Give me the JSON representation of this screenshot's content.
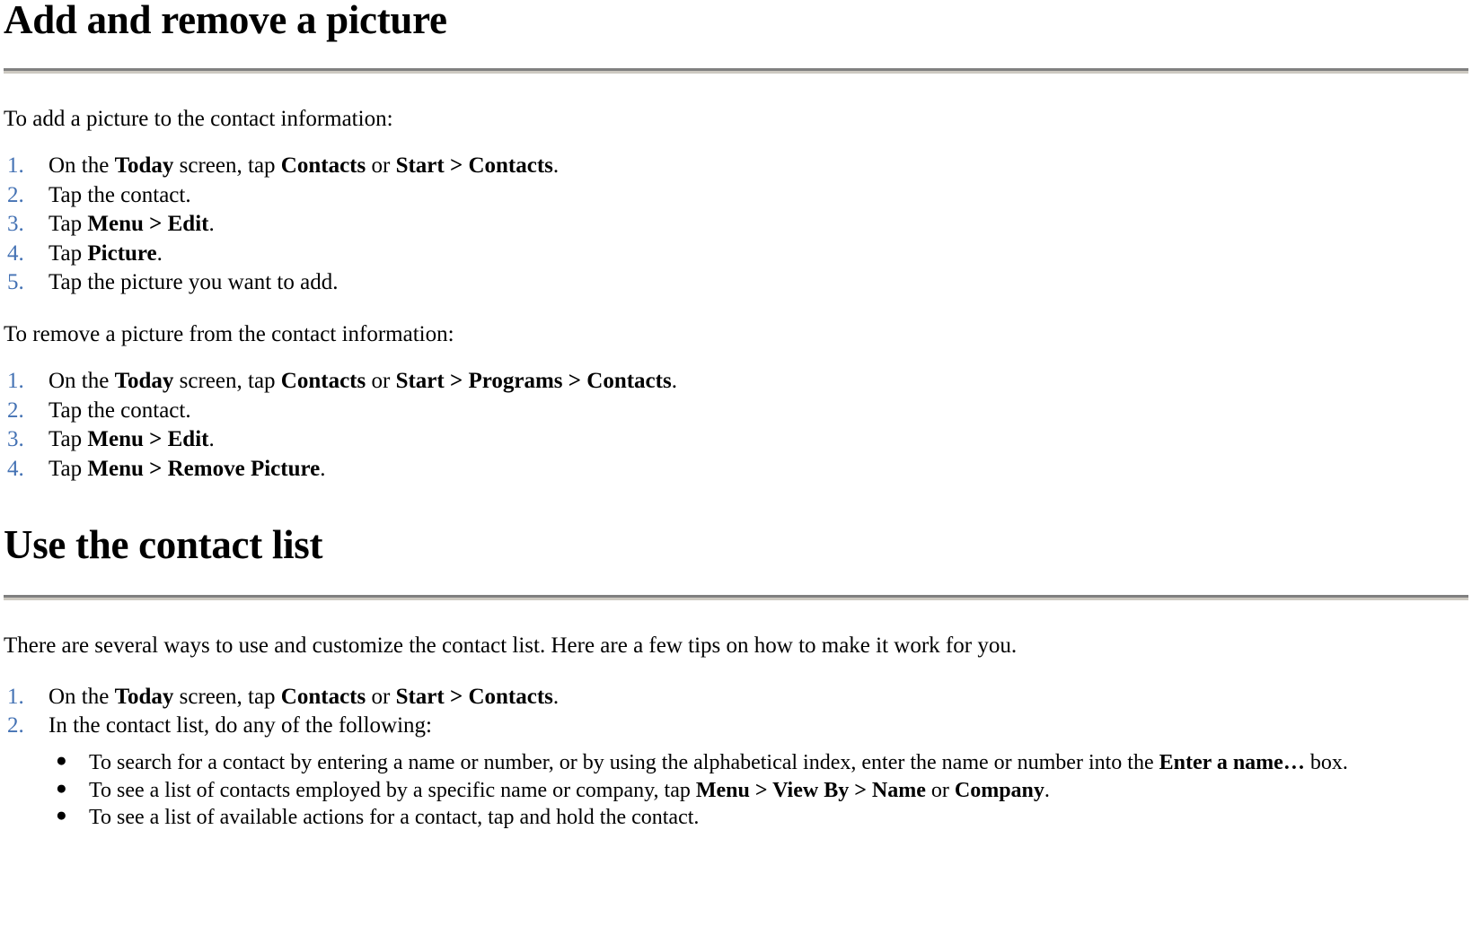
{
  "document": {
    "sections": [
      {
        "id": "add-remove-picture",
        "title": "Add and remove a picture",
        "intro_1": "To add a picture to the contact information:",
        "list_1": [
          {
            "num": "1.",
            "parts": [
              {
                "t": "On the ",
                "b": false
              },
              {
                "t": "Today",
                "b": true
              },
              {
                "t": " screen, tap ",
                "b": false
              },
              {
                "t": "Contacts",
                "b": true
              },
              {
                "t": " or ",
                "b": false
              },
              {
                "t": "Start > Contacts",
                "b": true
              },
              {
                "t": ".",
                "b": false
              }
            ]
          },
          {
            "num": "2.",
            "parts": [
              {
                "t": "Tap the contact.",
                "b": false
              }
            ]
          },
          {
            "num": "3.",
            "parts": [
              {
                "t": "Tap ",
                "b": false
              },
              {
                "t": "Menu > Edit",
                "b": true
              },
              {
                "t": ".",
                "b": false
              }
            ]
          },
          {
            "num": "4.",
            "parts": [
              {
                "t": "Tap ",
                "b": false
              },
              {
                "t": "Picture",
                "b": true
              },
              {
                "t": ".",
                "b": false
              }
            ]
          },
          {
            "num": "5.",
            "parts": [
              {
                "t": "Tap the picture you want to add.",
                "b": false
              }
            ]
          }
        ],
        "intro_2": "To remove a picture from the contact information:",
        "list_2": [
          {
            "num": "1.",
            "parts": [
              {
                "t": "On the ",
                "b": false
              },
              {
                "t": "Today",
                "b": true
              },
              {
                "t": " screen, tap ",
                "b": false
              },
              {
                "t": "Contacts",
                "b": true
              },
              {
                "t": " or ",
                "b": false
              },
              {
                "t": "Start > Programs > Contacts",
                "b": true
              },
              {
                "t": ".",
                "b": false
              }
            ]
          },
          {
            "num": "2.",
            "parts": [
              {
                "t": "Tap the contact.",
                "b": false
              }
            ]
          },
          {
            "num": "3.",
            "parts": [
              {
                "t": "Tap ",
                "b": false
              },
              {
                "t": "Menu > Edit",
                "b": true
              },
              {
                "t": ".",
                "b": false
              }
            ]
          },
          {
            "num": "4.",
            "parts": [
              {
                "t": "Tap ",
                "b": false
              },
              {
                "t": "Menu > Remove Picture",
                "b": true
              },
              {
                "t": ".",
                "b": false
              }
            ]
          }
        ]
      },
      {
        "id": "use-contact-list",
        "title": "Use the contact list",
        "intro_1": "There are several ways to use and customize the contact list. Here are a few tips on how to make it work for you.",
        "list_1": [
          {
            "num": "1.",
            "parts": [
              {
                "t": "On the ",
                "b": false
              },
              {
                "t": "Today",
                "b": true
              },
              {
                "t": " screen, tap ",
                "b": false
              },
              {
                "t": "Contacts",
                "b": true
              },
              {
                "t": " or ",
                "b": false
              },
              {
                "t": "Start > Contacts",
                "b": true
              },
              {
                "t": ".",
                "b": false
              }
            ]
          },
          {
            "num": "2.",
            "parts": [
              {
                "t": "In the contact list, do any of the following:",
                "b": false
              }
            ]
          }
        ],
        "bullets": [
          {
            "marker": "bullet-dot",
            "parts": [
              {
                "t": "To search for a contact by entering a name or number, or by using the alphabetical index, enter the name or number into the ",
                "b": false
              },
              {
                "t": "Enter a name…",
                "b": true
              },
              {
                "t": " box.",
                "b": false
              }
            ]
          },
          {
            "marker": "bullet-dot",
            "parts": [
              {
                "t": "To see a list of contacts employed by a specific name or company, tap ",
                "b": false
              },
              {
                "t": "Menu > View By > Name",
                "b": true
              },
              {
                "t": " or ",
                "b": false
              },
              {
                "t": "Company",
                "b": true
              },
              {
                "t": ".",
                "b": false
              }
            ]
          },
          {
            "marker": "bullet-dot",
            "parts": [
              {
                "t": "To see a list of available actions for a contact, tap and hold the contact.",
                "b": false
              }
            ]
          }
        ]
      }
    ],
    "glyphs": {
      "bullet_dot": "●"
    },
    "colors": {
      "list_number": "#4472b4",
      "rule_top": "#808080",
      "rule_bottom": "#cdc9c1",
      "text": "#000000",
      "background": "#ffffff"
    }
  }
}
